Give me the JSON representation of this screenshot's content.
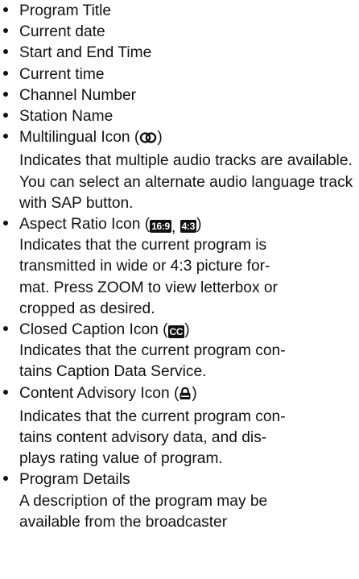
{
  "items": [
    {
      "title": "Program Title"
    },
    {
      "title": "Current date"
    },
    {
      "title": "Start and End Time"
    },
    {
      "title": "Current time"
    },
    {
      "title": "Channel Number"
    },
    {
      "title": "Station Name"
    },
    {
      "title": "Multilingual Icon (",
      "icon_name": "multilingual-icon",
      "title_end": ")",
      "desc": "Indicates that multiple audio tracks are available. You can select an alternate audio language track with SAP button."
    },
    {
      "title": "Aspect Ratio Icon (",
      "badge1": "16:9",
      "sep": ",",
      "badge2": "4:3",
      "title_end": ")",
      "desc_lines": [
        "Indicates that the current program is",
        "transmitted in wide or 4:3 picture for-",
        "mat. Press ZOOM to view letterbox or",
        "cropped as desired."
      ]
    },
    {
      "title": "Closed Caption Icon (",
      "badge": "CC",
      "title_end": ")",
      "desc_lines": [
        "Indicates that the current program con-",
        "tains Caption Data Service."
      ]
    },
    {
      "title": "Content Advisory Icon (",
      "icon_name": "lock-icon",
      "title_end": ")",
      "desc_lines": [
        "Indicates that the current program con-",
        "tains content advisory data, and dis-",
        "plays rating value of program."
      ]
    },
    {
      "title": "Program Details",
      "desc_lines": [
        "A description of the program may be",
        "available from the broadcaster"
      ]
    }
  ]
}
